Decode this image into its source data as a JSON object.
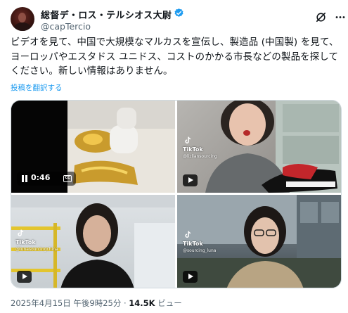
{
  "author": {
    "display_name": "総督デ・ロス・テルシオス大尉",
    "handle": "@capTercio"
  },
  "tweet": {
    "text": "ビデオを見て、中国で大規模なマルカスを宣伝し、製造品 (中国製) を見て、ヨーロッパやエスタドス ユニドス、コストのかかる市長などの製品を探してください。新しい情報はありません。",
    "translate_label": "投稿を翻訳する"
  },
  "media": {
    "video1": {
      "time": "0:46",
      "cc": "CC"
    },
    "tiles": [
      {
        "tiktok_label": "TikTok",
        "tiktok_user": "@lizliansourcing"
      },
      {
        "tiktok_label": "TikTok",
        "tiktok_user": "@lunasourcingchina"
      },
      {
        "tiktok_label": "TikTok",
        "tiktok_user": "@sourcing_luna"
      }
    ]
  },
  "meta": {
    "date": "2025年4月15日 午後9時25分",
    "separator": "·",
    "views_count": "14.5K",
    "views_label": "ビュー"
  },
  "colors": {
    "accent": "#1d9bf0",
    "text": "#0f1419",
    "secondary": "#536471"
  },
  "icons": [
    "verified-badge-icon",
    "grok-icon",
    "more-icon",
    "pause-icon",
    "cc-icon",
    "play-icon",
    "tiktok-icon"
  ]
}
